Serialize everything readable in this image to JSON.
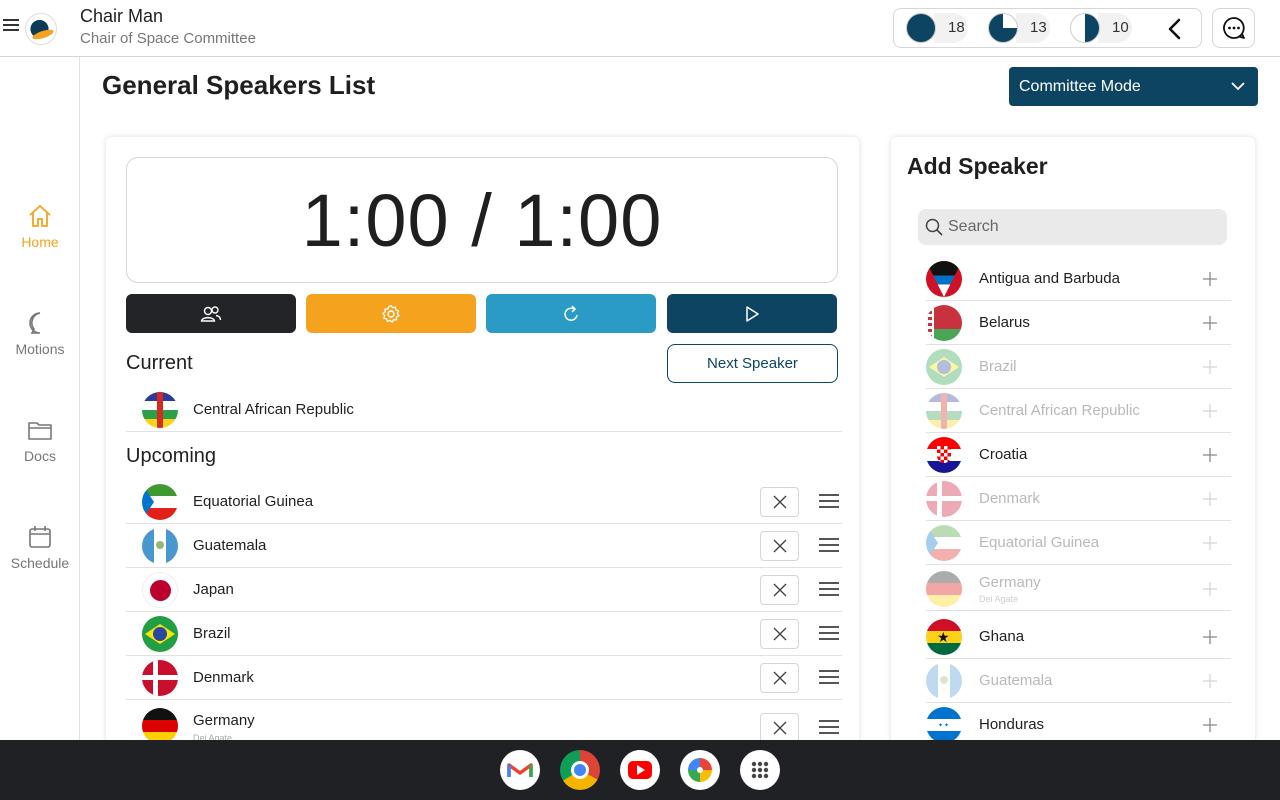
{
  "header": {
    "user_name": "Chair Man",
    "user_role": "Chair of Space Committee",
    "stats": [
      {
        "value": "18",
        "fraction": 1.0,
        "icon": "full-circle-icon"
      },
      {
        "value": "13",
        "fraction": 0.75,
        "icon": "three-quarter-circle-icon"
      },
      {
        "value": "10",
        "fraction": 0.5,
        "icon": "half-circle-icon"
      }
    ]
  },
  "sidebar": {
    "items": [
      {
        "label": "Home",
        "icon": "home-icon",
        "active": true
      },
      {
        "label": "Motions",
        "icon": "speech-bubble-icon",
        "active": false
      },
      {
        "label": "Docs",
        "icon": "folder-icon",
        "active": false
      },
      {
        "label": "Schedule",
        "icon": "calendar-icon",
        "active": false
      }
    ]
  },
  "page": {
    "title": "General Speakers List",
    "mode": "Committee Mode"
  },
  "timer": {
    "display": "1:00 / 1:00"
  },
  "controls": [
    {
      "icon": "people-icon",
      "color": "#232428"
    },
    {
      "icon": "gear-icon",
      "color": "#f5a31e"
    },
    {
      "icon": "refresh-icon",
      "color": "#2a9bc4"
    },
    {
      "icon": "play-icon",
      "color": "#0d4461"
    }
  ],
  "current": {
    "title": "Current",
    "next_label": "Next Speaker",
    "speaker": "Central African Republic"
  },
  "upcoming": {
    "title": "Upcoming",
    "items": [
      {
        "name": "Equatorial Guinea",
        "sub": ""
      },
      {
        "name": "Guatemala",
        "sub": ""
      },
      {
        "name": "Japan",
        "sub": ""
      },
      {
        "name": "Brazil",
        "sub": ""
      },
      {
        "name": "Denmark",
        "sub": ""
      },
      {
        "name": "Germany",
        "sub": "Dei Agate"
      }
    ]
  },
  "add_speaker": {
    "title": "Add Speaker",
    "search_placeholder": "Search",
    "items": [
      {
        "name": "Antigua and Barbuda",
        "sub": "",
        "dim": false
      },
      {
        "name": "Belarus",
        "sub": "",
        "dim": false
      },
      {
        "name": "Brazil",
        "sub": "",
        "dim": true
      },
      {
        "name": "Central African Republic",
        "sub": "",
        "dim": true
      },
      {
        "name": "Croatia",
        "sub": "",
        "dim": false
      },
      {
        "name": "Denmark",
        "sub": "",
        "dim": true
      },
      {
        "name": "Equatorial Guinea",
        "sub": "",
        "dim": true
      },
      {
        "name": "Germany",
        "sub": "Dei Agate",
        "dim": true
      },
      {
        "name": "Ghana",
        "sub": "",
        "dim": false
      },
      {
        "name": "Guatemala",
        "sub": "",
        "dim": true
      },
      {
        "name": "Honduras",
        "sub": "",
        "dim": false
      }
    ]
  },
  "taskbar": {
    "apps": [
      {
        "icon": "gmail-icon"
      },
      {
        "icon": "chrome-icon"
      },
      {
        "icon": "youtube-icon"
      },
      {
        "icon": "photos-icon"
      },
      {
        "icon": "app-launcher-icon"
      }
    ]
  },
  "colors": {
    "accent": "#f5a31e",
    "primary": "#0d4461",
    "dark": "#232428",
    "cyan": "#2a9bc4"
  }
}
